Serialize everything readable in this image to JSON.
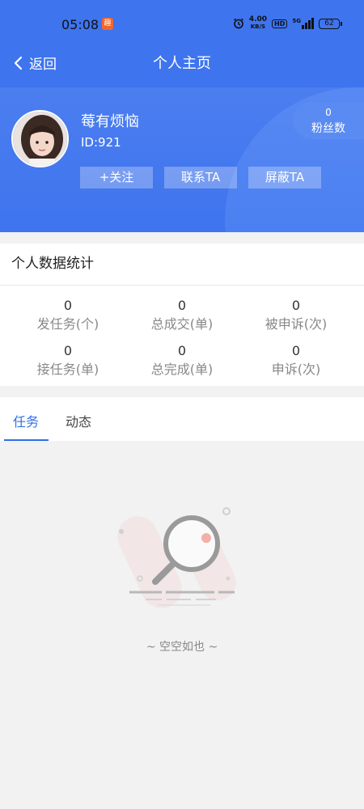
{
  "status_bar": {
    "time": "05:08",
    "app_badge": "趣",
    "net_speed_top": "4.00",
    "net_speed_bottom": "KB/S",
    "hd": "HD",
    "network": "5G",
    "battery": "62"
  },
  "nav": {
    "back_label": "返回",
    "title": "个人主页"
  },
  "profile": {
    "name": "莓有烦恼",
    "id_text": "ID:921",
    "fans_count": "0",
    "fans_label": "粉丝数",
    "buttons": {
      "follow": "+关注",
      "contact": "联系TA",
      "block": "屏蔽TA"
    }
  },
  "stats": {
    "title": "个人数据统计",
    "items": [
      {
        "value": "0",
        "label": "发任务(个)"
      },
      {
        "value": "0",
        "label": "总成交(单)"
      },
      {
        "value": "0",
        "label": "被申诉(次)"
      },
      {
        "value": "0",
        "label": "接任务(单)"
      },
      {
        "value": "0",
        "label": "总完成(单)"
      },
      {
        "value": "0",
        "label": "申诉(次)"
      }
    ]
  },
  "tabs": [
    {
      "label": "任务",
      "active": true
    },
    {
      "label": "动态",
      "active": false
    }
  ],
  "empty_state": {
    "text": "~ 空空如也 ~",
    "icon": "magnifier-illustration"
  },
  "colors": {
    "primary": "#3e74ee",
    "tab_active": "#2f6fe8",
    "background": "#f2f2f2"
  }
}
